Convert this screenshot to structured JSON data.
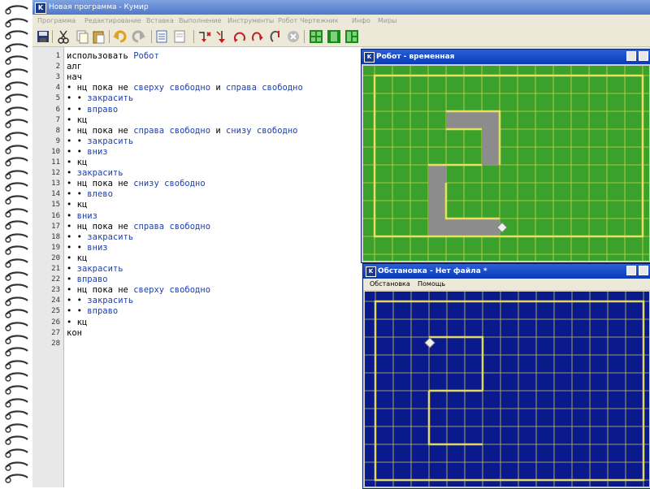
{
  "window": {
    "title": "Новая программа - Кумир",
    "icon_letter": "K"
  },
  "menu": [
    "Программа",
    "Редактирование",
    "Вставка",
    "Выполнение",
    "Инструменты",
    "Робот",
    "Чертежник",
    "Инфо",
    "Миры"
  ],
  "toolbar_icons": [
    "save-icon",
    "cut-icon",
    "copy-icon",
    "paste-icon",
    "undo-icon",
    "redo-icon",
    "insert-icon",
    "delete-icon",
    "run-icon",
    "step-icon",
    "step-in-icon",
    "step-out-icon",
    "stop-icon",
    "cancel-icon",
    "grid-icon",
    "window-icon",
    "layout-icon"
  ],
  "editor": {
    "lines": [
      {
        "n": "1",
        "t": "использовать Робот"
      },
      {
        "n": "2",
        "t": "алг"
      },
      {
        "n": "3",
        "t": "нач"
      },
      {
        "n": "4",
        "t": "• нц пока не сверху свободно и справа свободно"
      },
      {
        "n": "5",
        "t": "• • закрасить"
      },
      {
        "n": "6",
        "t": "• • вправо"
      },
      {
        "n": "7",
        "t": "• кц"
      },
      {
        "n": "8",
        "t": "• нц пока не справа свободно и снизу свободно"
      },
      {
        "n": "9",
        "t": "• • закрасить"
      },
      {
        "n": "10",
        "t": "• • вниз"
      },
      {
        "n": "11",
        "t": "• кц"
      },
      {
        "n": "12",
        "t": "• закрасить"
      },
      {
        "n": "13",
        "t": "• нц пока не снизу свободно"
      },
      {
        "n": "14",
        "t": "• • влево"
      },
      {
        "n": "15",
        "t": "• кц"
      },
      {
        "n": "16",
        "t": "• вниз"
      },
      {
        "n": "17",
        "t": "• нц пока не справа свободно"
      },
      {
        "n": "18",
        "t": "• • закрасить"
      },
      {
        "n": "19",
        "t": "• • вниз"
      },
      {
        "n": "20",
        "t": "• кц"
      },
      {
        "n": "21",
        "t": "• закрасить"
      },
      {
        "n": "22",
        "t": "• вправо"
      },
      {
        "n": "23",
        "t": "• нц пока не сверху свободно"
      },
      {
        "n": "24",
        "t": "• • закрасить"
      },
      {
        "n": "25",
        "t": "• • вправо"
      },
      {
        "n": "26",
        "t": "• кц"
      },
      {
        "n": "27",
        "t": "кон"
      },
      {
        "n": "28",
        "t": ""
      }
    ]
  },
  "robot_window": {
    "title": "Робот - временная",
    "icon_letter": "K",
    "bg_color": "#3aa12c",
    "grid_color": "#d6d04a",
    "paint_color": "#8c8c8c"
  },
  "env_window": {
    "title": "Обстановка - Нет файла *",
    "icon_letter": "K",
    "menu": [
      "Обстановка",
      "Помощь"
    ],
    "bg_color": "#0a1a8c",
    "grid_color": "#c9c55a"
  }
}
